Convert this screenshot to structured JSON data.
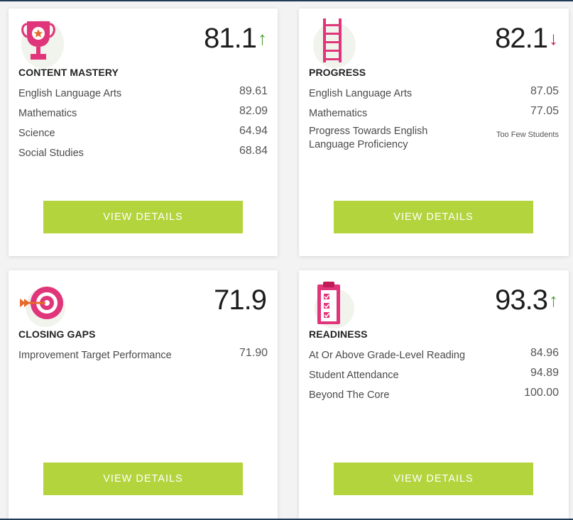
{
  "colors": {
    "accent_pink": "#e0357a",
    "button_green": "#b4d43e",
    "arrow_up": "#4b9a2f",
    "arrow_down": "#c11a59",
    "frame": "#1f3b57"
  },
  "cards": [
    {
      "title": "CONTENT MASTERY",
      "icon": "trophy-icon",
      "score": "81.1",
      "trend": "up",
      "trend_symbol": "↑",
      "metrics": [
        {
          "label": "English Language Arts",
          "value": "89.61"
        },
        {
          "label": "Mathematics",
          "value": "82.09"
        },
        {
          "label": "Science",
          "value": "64.94"
        },
        {
          "label": "Social Studies",
          "value": "68.84"
        }
      ],
      "button": "VIEW DETAILS"
    },
    {
      "title": "PROGRESS",
      "icon": "ladder-icon",
      "score": "82.1",
      "trend": "down",
      "trend_symbol": "↓",
      "metrics": [
        {
          "label": "English Language Arts",
          "value": "87.05"
        },
        {
          "label": "Mathematics",
          "value": "77.05"
        },
        {
          "label": "Progress Towards English Language Proficiency",
          "value": "Too Few Students"
        }
      ],
      "button": "VIEW DETAILS"
    },
    {
      "title": "CLOSING GAPS",
      "icon": "target-icon",
      "score": "71.9",
      "trend": "none",
      "trend_symbol": "",
      "metrics": [
        {
          "label": "Improvement Target Performance",
          "value": "71.90"
        }
      ],
      "button": "VIEW DETAILS"
    },
    {
      "title": "READINESS",
      "icon": "checklist-icon",
      "score": "93.3",
      "trend": "up",
      "trend_symbol": "↑",
      "metrics": [
        {
          "label": "At Or Above Grade-Level Reading",
          "value": "84.96"
        },
        {
          "label": "Student Attendance",
          "value": "94.89"
        },
        {
          "label": "Beyond The Core",
          "value": "100.00"
        }
      ],
      "button": "VIEW DETAILS"
    }
  ]
}
